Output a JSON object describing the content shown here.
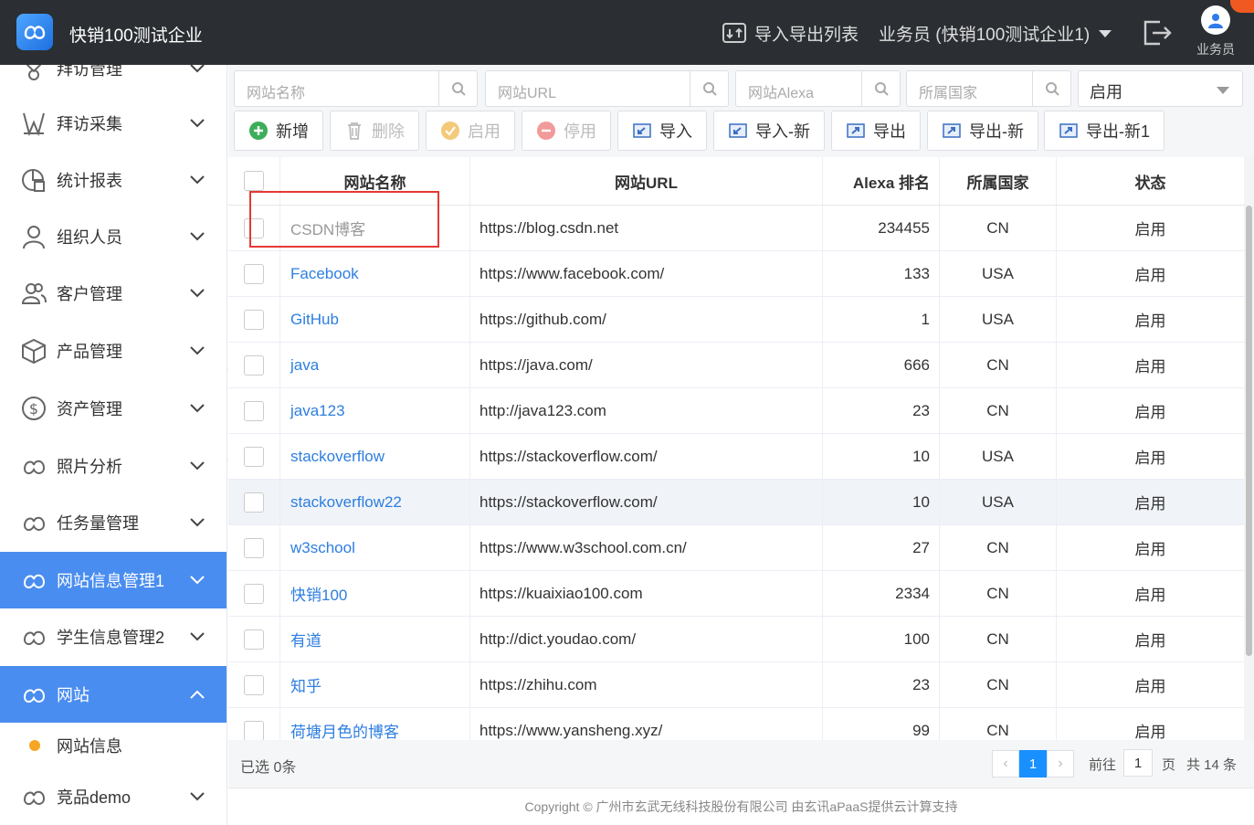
{
  "header": {
    "company": "快销100测试企业",
    "import_export_list": "导入导出列表",
    "role": "业务员 (快销100测试企业1)",
    "user_label": "业务员"
  },
  "sidebar": {
    "items": [
      {
        "label": "拜访管理",
        "icon": "visit-icon"
      },
      {
        "label": "拜访采集",
        "icon": "collect-icon"
      },
      {
        "label": "统计报表",
        "icon": "chart-icon"
      },
      {
        "label": "组织人员",
        "icon": "person-icon"
      },
      {
        "label": "客户管理",
        "icon": "customers-icon"
      },
      {
        "label": "产品管理",
        "icon": "box-icon"
      },
      {
        "label": "资产管理",
        "icon": "dollar-icon"
      },
      {
        "label": "照片分析",
        "icon": "cloud-icon"
      },
      {
        "label": "任务量管理",
        "icon": "cloud-icon"
      },
      {
        "label": "网站信息管理1",
        "icon": "cloud-icon",
        "active": true
      },
      {
        "label": "学生信息管理2",
        "icon": "cloud-icon"
      },
      {
        "label": "网站",
        "icon": "cloud-icon",
        "active": true,
        "expanded": true
      },
      {
        "label": "竞品demo",
        "icon": "cloud-icon"
      }
    ],
    "submenu": {
      "label": "网站信息"
    }
  },
  "filters": {
    "name_placeholder": "网站名称",
    "url_placeholder": "网站URL",
    "alexa_placeholder": "网站Alexa",
    "country_placeholder": "所属国家",
    "status_value": "启用"
  },
  "toolbar": {
    "add": "新增",
    "delete": "删除",
    "enable": "启用",
    "disable": "停用",
    "import": "导入",
    "import_new": "导入-新",
    "export": "导出",
    "export_new": "导出-新",
    "export_new1": "导出-新1"
  },
  "table": {
    "headers": {
      "name": "网站名称",
      "url": "网站URL",
      "alexa": "Alexa 排名",
      "country": "所属国家",
      "status": "状态"
    },
    "rows": [
      {
        "name": "CSDN博客",
        "url": "https://blog.csdn.net",
        "alexa": "234455",
        "country": "CN",
        "status": "启用"
      },
      {
        "name": "Facebook",
        "url": "https://www.facebook.com/",
        "alexa": "133",
        "country": "USA",
        "status": "启用"
      },
      {
        "name": "GitHub",
        "url": "https://github.com/",
        "alexa": "1",
        "country": "USA",
        "status": "启用"
      },
      {
        "name": "java",
        "url": "https://java.com/",
        "alexa": "666",
        "country": "CN",
        "status": "启用"
      },
      {
        "name": "java123",
        "url": "http://java123.com",
        "alexa": "23",
        "country": "CN",
        "status": "启用"
      },
      {
        "name": "stackoverflow",
        "url": "https://stackoverflow.com/",
        "alexa": "10",
        "country": "USA",
        "status": "启用"
      },
      {
        "name": "stackoverflow22",
        "url": "https://stackoverflow.com/",
        "alexa": "10",
        "country": "USA",
        "status": "启用"
      },
      {
        "name": "w3school",
        "url": "https://www.w3school.com.cn/",
        "alexa": "27",
        "country": "CN",
        "status": "启用"
      },
      {
        "name": "快销100",
        "url": "https://kuaixiao100.com",
        "alexa": "2334",
        "country": "CN",
        "status": "启用"
      },
      {
        "name": "有道",
        "url": "http://dict.youdao.com/",
        "alexa": "100",
        "country": "CN",
        "status": "启用"
      },
      {
        "name": "知乎",
        "url": "https://zhihu.com",
        "alexa": "23",
        "country": "CN",
        "status": "启用"
      },
      {
        "name": "荷塘月色的博客",
        "url": "https://www.yansheng.xyz/",
        "alexa": "99",
        "country": "CN",
        "status": "启用"
      }
    ]
  },
  "pager": {
    "selected": "已选 0条",
    "current_page": "1",
    "goto_label": "前往",
    "goto_value": "1",
    "page_suffix": "页",
    "total": "共 14 条"
  },
  "footer": {
    "copyright": "Copyright © 广州市玄武无线科技股份有限公司 由玄讯aPaaS提供云计算支持"
  },
  "colors": {
    "accent": "#4a8df0",
    "topbar": "#2b2f33",
    "link": "#2d7ee0",
    "highlight": "#e53935"
  }
}
